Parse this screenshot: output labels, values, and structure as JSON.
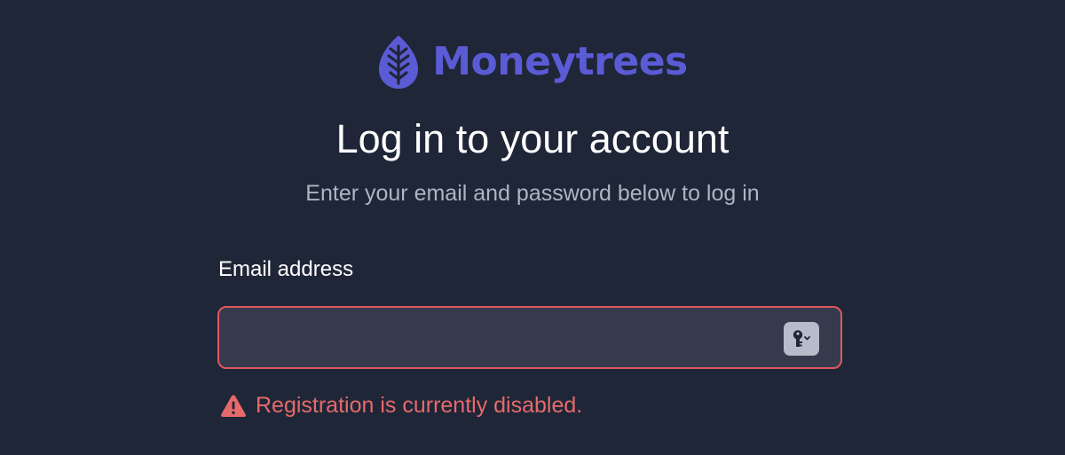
{
  "brand": {
    "name": "Moneytrees",
    "accent_color": "#5b5bd6",
    "logo_icon": "leaf-icon"
  },
  "header": {
    "title": "Log in to your account",
    "subtitle": "Enter your email and password below to log in"
  },
  "form": {
    "email": {
      "label": "Email address",
      "value": "",
      "placeholder": "",
      "error_border_color": "#e0575f",
      "password_manager_icon": "key-icon"
    },
    "error": {
      "icon": "warning-triangle-icon",
      "message": "Registration is currently disabled.",
      "color": "#e66a6a"
    }
  }
}
